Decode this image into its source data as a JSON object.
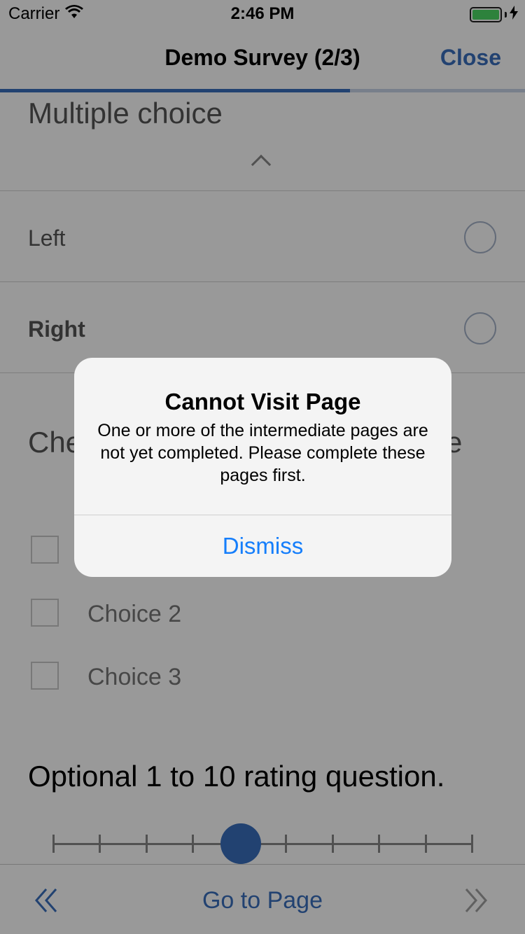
{
  "status_bar": {
    "carrier": "Carrier",
    "time": "2:46 PM",
    "battery_color": "#4cd964"
  },
  "nav": {
    "title": "Demo Survey (2/3)",
    "close_label": "Close",
    "progress": 0.667
  },
  "question1": {
    "title": "Multiple choice",
    "options": [
      {
        "label": "Left",
        "selected": false
      },
      {
        "label": "Right",
        "selected": false
      }
    ]
  },
  "question2": {
    "title": "Che",
    "title_tail": "e",
    "choices": [
      {
        "label": "",
        "checked": false
      },
      {
        "label": "Choice 2",
        "checked": false
      },
      {
        "label": "Choice 3",
        "checked": false
      }
    ]
  },
  "question3": {
    "title": "Optional 1 to 10 rating question.",
    "slider_value_index": 4
  },
  "bottom_bar": {
    "prev_icon": "double-chevron-left",
    "goto_label": "Go to Page",
    "next_icon": "double-chevron-right"
  },
  "alert": {
    "title": "Cannot Visit Page",
    "message": "One or more of the intermediate pages are not yet completed. Please complete these pages first.",
    "dismiss_label": "Dismiss"
  },
  "colors": {
    "accent": "#3a6fbd",
    "alert_button": "#157efb"
  }
}
